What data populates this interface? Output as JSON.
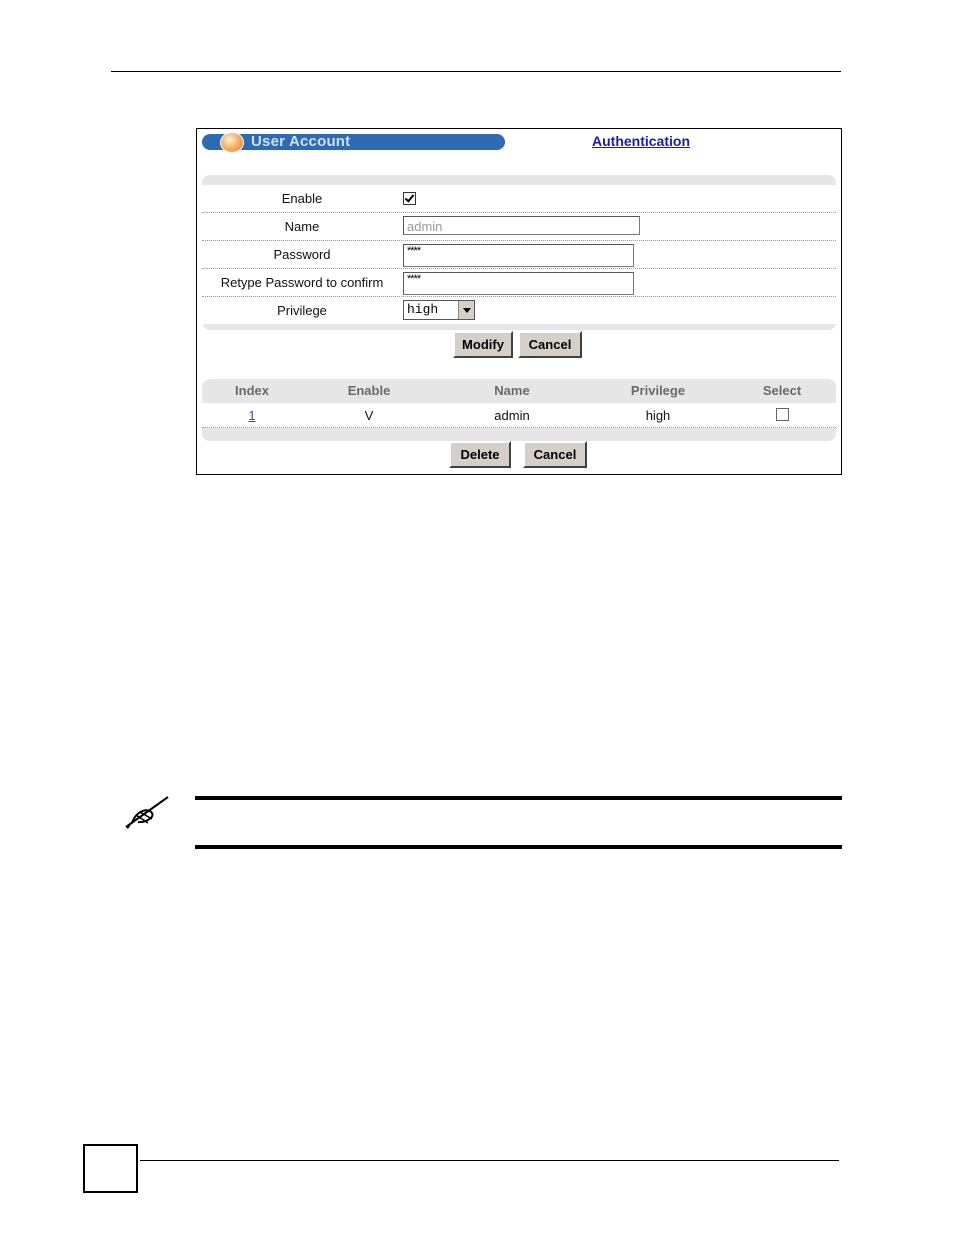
{
  "screenshot": {
    "title": "User Account",
    "auth_link": "Authentication",
    "form": {
      "enable_label": "Enable",
      "enable_checked": true,
      "name_label": "Name",
      "name_value": "admin",
      "password_label": "Password",
      "password_value": "****",
      "retype_label": "Retype Password to confirm",
      "retype_value": "****",
      "privilege_label": "Privilege",
      "privilege_value": "high"
    },
    "modify_btn": "Modify",
    "cancel_btn": "Cancel",
    "table": {
      "headers": [
        "Index",
        "Enable",
        "Name",
        "Privilege",
        "Select"
      ],
      "rows": [
        {
          "index": "1",
          "enable": "V",
          "name": "admin",
          "privilege": "high"
        }
      ]
    },
    "delete_btn": "Delete",
    "cancel2_btn": "Cancel"
  },
  "icons": {
    "note": "pencil-note-icon",
    "orb": "orange-orb-icon"
  }
}
